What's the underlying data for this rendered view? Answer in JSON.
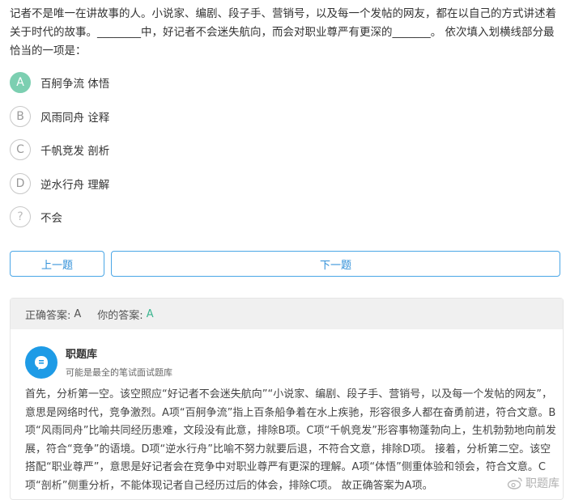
{
  "question": {
    "text": "记者不是唯一在讲故事的人。小说家、编剧、段子手、营销号，以及每一个发帖的网友，都在以自己的方式讲述着关于时代的故事。________中，好记者不会迷失航向，而会对职业尊严有更深的_______。 依次填入划横线部分最恰当的一项是："
  },
  "options": [
    {
      "key": "A",
      "text": "百舸争流 体悟",
      "selected": true
    },
    {
      "key": "B",
      "text": "风雨同舟 诠释",
      "selected": false
    },
    {
      "key": "C",
      "text": "千帆竞发 剖析",
      "selected": false
    },
    {
      "key": "D",
      "text": "逆水行舟 理解",
      "selected": false
    },
    {
      "key": "?",
      "text": "不会",
      "selected": false
    }
  ],
  "nav": {
    "prev_label": "上一题",
    "next_label": "下一题"
  },
  "answer": {
    "correct_label": "正确答案:",
    "correct_value": "A",
    "mine_label": "你的答案:",
    "mine_value": "A"
  },
  "source": {
    "name": "职题库",
    "desc": "可能是最全的笔试面试题库"
  },
  "explanation": "首先，分析第一空。该空照应“好记者不会迷失航向”“小说家、编剧、段子手、营销号，以及每一个发帖的网友”，意思是网络时代，竞争激烈。A项“百舸争流”指上百条船争着在水上疾驰，形容很多人都在奋勇前进，符合文意。B项“风雨同舟”比喻共同经历患难，文段没有此意，排除B项。C项“千帆竞发”形容事物蓬勃向上，生机勃勃地向前发展，符合“竞争”的语境。D项“逆水行舟”比喻不努力就要后退，不符合文意，排除D项。 接着，分析第二空。该空搭配“职业尊严”，意思是好记者会在竞争中对职业尊严有更深的理解。A项“体悟”侧重体验和领会，符合文意。C项“剖析”侧重分析，不能体现记者自己经历过后的体会，排除C项。 故正确答案为A项。",
  "watermark": {
    "text": "职题库"
  },
  "colors": {
    "selected": "#7ccfb1",
    "accent": "#2f8fd8",
    "logo": "#1e9be6"
  }
}
